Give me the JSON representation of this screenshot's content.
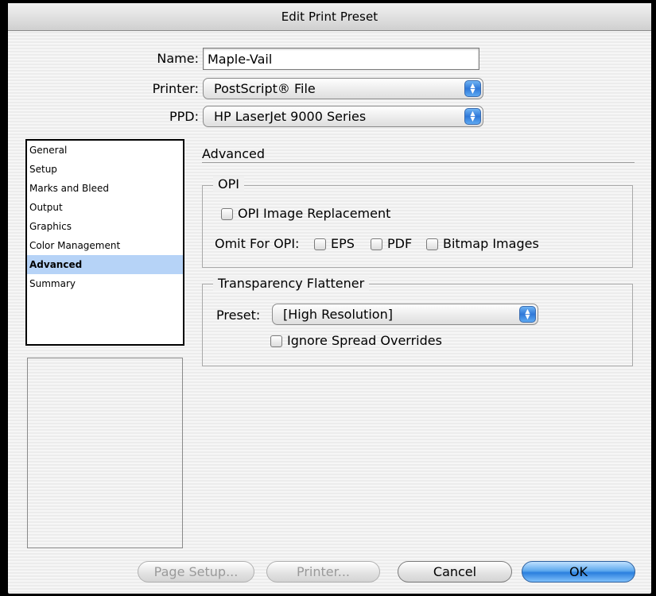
{
  "dialog": {
    "title": "Edit Print Preset"
  },
  "form": {
    "name_label": "Name:",
    "name_value": "Maple-Vail",
    "printer_label": "Printer:",
    "printer_value": "PostScript® File",
    "ppd_label": "PPD:",
    "ppd_value": "HP LaserJet 9000 Series"
  },
  "sidebar": {
    "items": [
      {
        "label": "General"
      },
      {
        "label": "Setup"
      },
      {
        "label": "Marks and Bleed"
      },
      {
        "label": "Output"
      },
      {
        "label": "Graphics"
      },
      {
        "label": "Color Management"
      },
      {
        "label": "Advanced"
      },
      {
        "label": "Summary"
      }
    ],
    "selected": "Advanced"
  },
  "panel": {
    "title": "Advanced",
    "opi": {
      "legend": "OPI",
      "image_replacement_label": "OPI Image Replacement",
      "image_replacement_checked": false,
      "omit_label": "Omit For OPI:",
      "omit_eps_label": "EPS",
      "omit_pdf_label": "PDF",
      "omit_bitmap_label": "Bitmap Images"
    },
    "flattener": {
      "legend": "Transparency Flattener",
      "preset_label": "Preset:",
      "preset_value": "[High Resolution]",
      "ignore_overrides_label": "Ignore Spread Overrides"
    }
  },
  "buttons": {
    "page_setup": "Page Setup...",
    "printer": "Printer...",
    "cancel": "Cancel",
    "ok": "OK"
  },
  "colors": {
    "accent": "#2b7fde",
    "selection": "#b6d3f7"
  }
}
